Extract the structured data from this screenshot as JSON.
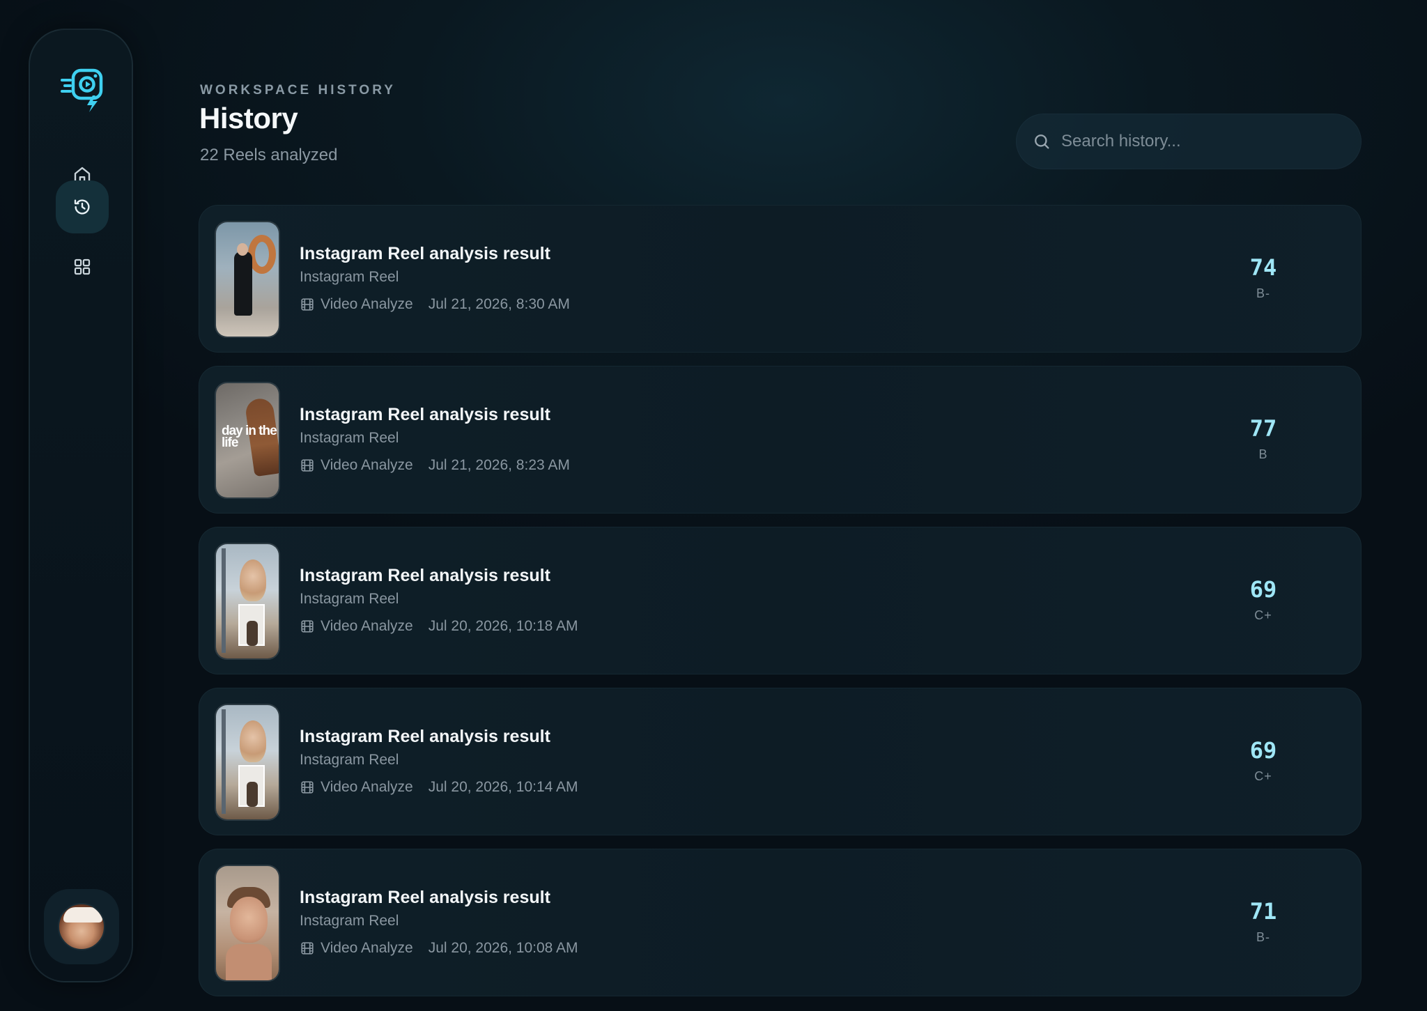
{
  "sidebar": {
    "items": [
      {
        "name": "home",
        "icon": "home-icon",
        "active": false
      },
      {
        "name": "history",
        "icon": "history-icon",
        "active": true
      },
      {
        "name": "grid",
        "icon": "grid-icon",
        "active": false
      }
    ],
    "accent": "#3fd0f0"
  },
  "header": {
    "eyebrow": "WORKSPACE HISTORY",
    "title": "History",
    "subtitle": "22 Reels analyzed"
  },
  "search": {
    "placeholder": "Search history..."
  },
  "entries": [
    {
      "title": "Instagram Reel analysis result",
      "type": "Instagram Reel",
      "mode": "Video Analyze",
      "date": "Jul 21, 2026, 8:30 AM",
      "score": "74",
      "grade": "B-",
      "thumb_text": ""
    },
    {
      "title": "Instagram Reel analysis result",
      "type": "Instagram Reel",
      "mode": "Video Analyze",
      "date": "Jul 21, 2026, 8:23 AM",
      "score": "77",
      "grade": "B",
      "thumb_text": "day in the life"
    },
    {
      "title": "Instagram Reel analysis result",
      "type": "Instagram Reel",
      "mode": "Video Analyze",
      "date": "Jul 20, 2026, 10:18 AM",
      "score": "69",
      "grade": "C+",
      "thumb_text": ""
    },
    {
      "title": "Instagram Reel analysis result",
      "type": "Instagram Reel",
      "mode": "Video Analyze",
      "date": "Jul 20, 2026, 10:14 AM",
      "score": "69",
      "grade": "C+",
      "thumb_text": ""
    },
    {
      "title": "Instagram Reel analysis result",
      "type": "Instagram Reel",
      "mode": "Video Analyze",
      "date": "Jul 20, 2026, 10:08 AM",
      "score": "71",
      "grade": "B-",
      "thumb_text": ""
    }
  ],
  "colors": {
    "score": "#9fe6f6",
    "muted": "#8a97a1"
  }
}
